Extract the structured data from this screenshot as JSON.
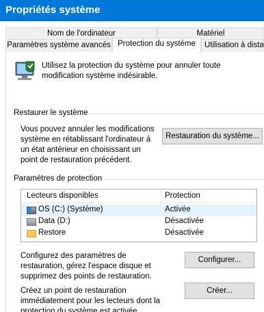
{
  "window": {
    "title": "Propriétés système"
  },
  "tabs": {
    "top_row": [
      "Nom de l'ordinateur",
      "Matériel"
    ],
    "bottom_row": [
      "Paramètres système avancés",
      "Protection du système",
      "Utilisation à distance"
    ],
    "active": "Protection du système"
  },
  "intro": {
    "icon": "system-protection-icon",
    "text": "Utilisez la protection du système pour annuler toute modification système indésirable."
  },
  "restore": {
    "section_label": "Restaurer le système",
    "description": "Vous pouvez annuler les modifications système en rétablissant l'ordinateur à un état antérieur en choisissant un point de restauration précédent.",
    "button_label": "Restauration du système..."
  },
  "protection": {
    "section_label": "Paramètres de protection",
    "columns": [
      "Lecteurs disponibles",
      "Protection"
    ],
    "drives": [
      {
        "name": "OS (C:) (Système)",
        "protection": "Activée",
        "icon": "system-drive-icon",
        "selected": true
      },
      {
        "name": "Data (D:)",
        "protection": "Désactivée",
        "icon": "drive-icon",
        "selected": false
      },
      {
        "name": "Restore",
        "protection": "Désactivée",
        "icon": "folder-icon",
        "selected": false
      }
    ],
    "configure_text": "Configurez des paramètres de restauration, gérez l'espace disque et supprimez des points de restauration.",
    "configure_button": "Configurer...",
    "create_text": "Créez un point de restauration immédiatement pour les lecteurs dont la protection du système est activée.",
    "create_button": "Créer..."
  },
  "colors": {
    "titlebar": "#0078d7",
    "selection": "#e5f3ff"
  }
}
